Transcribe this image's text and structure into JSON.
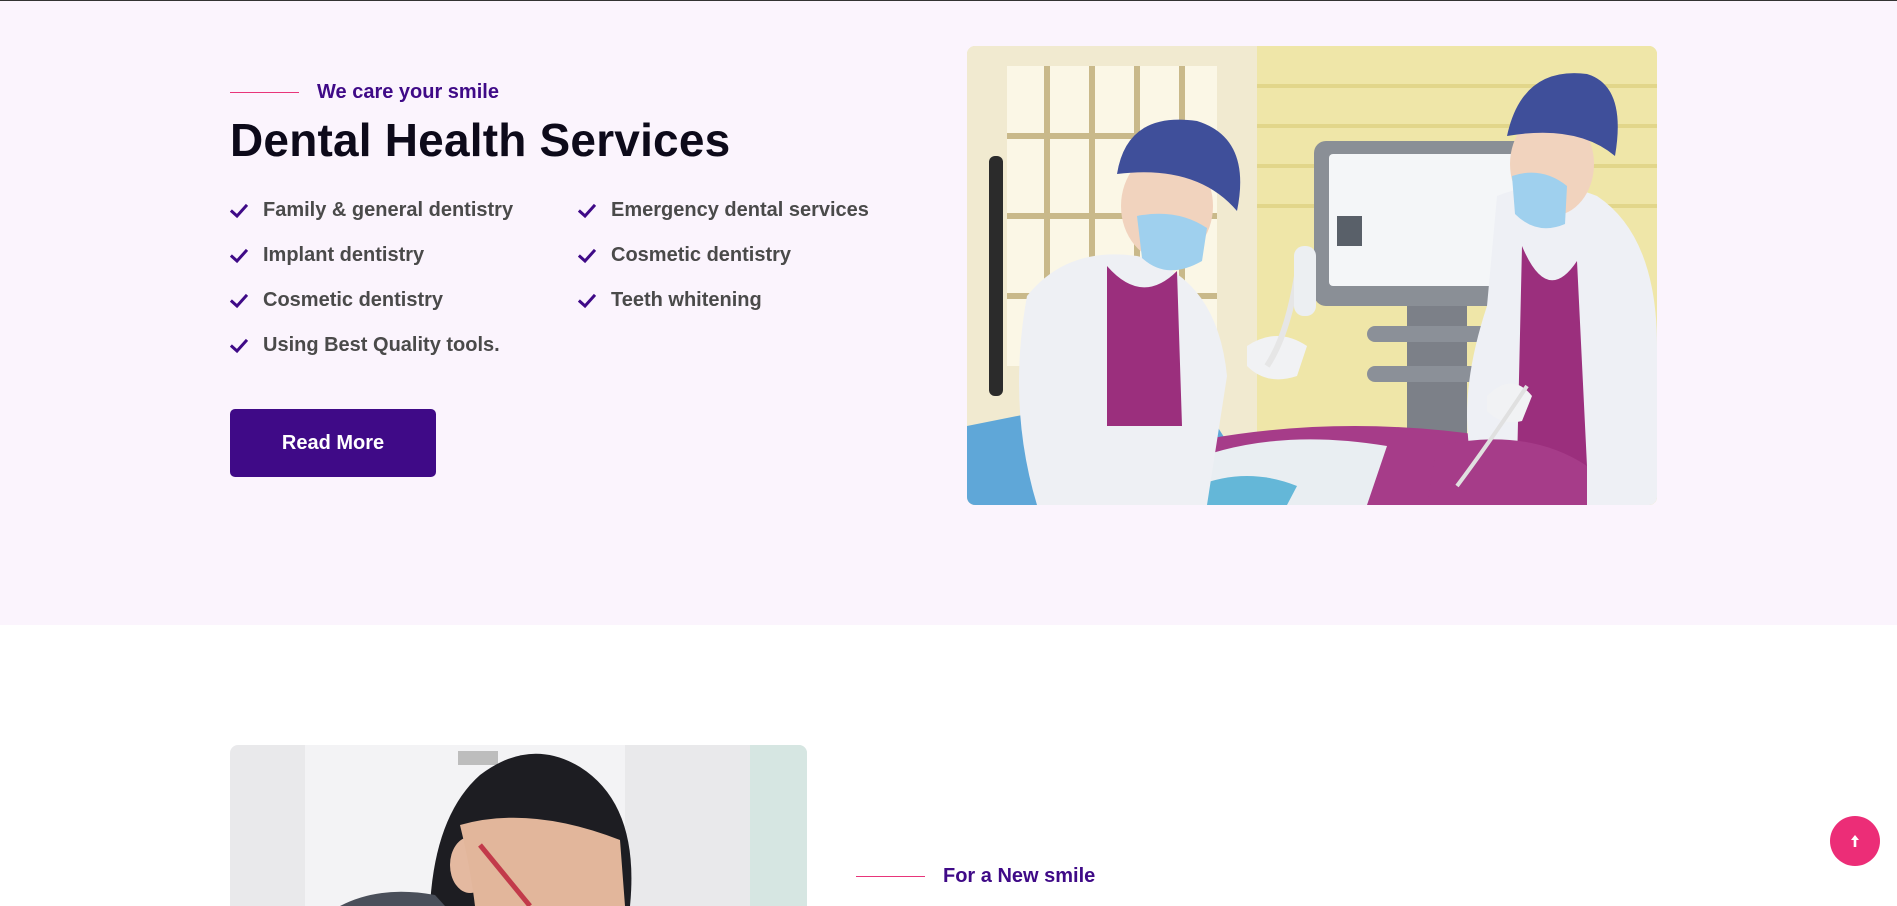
{
  "services": {
    "eyebrow": "We care your smile",
    "title": "Dental Health Services",
    "features_left": [
      "Family & general dentistry",
      "Implant dentistry",
      "Cosmetic dentistry",
      "Using Best Quality tools."
    ],
    "features_right": [
      "Emergency dental services",
      "Cosmetic dentistry",
      "Teeth whitening"
    ],
    "button_label": "Read More",
    "image_icon": "dentists-photo"
  },
  "next_section": {
    "eyebrow": "For a New smile",
    "image_icon": "dentist-photo"
  },
  "scroll_top": {
    "icon": "arrow-up-icon"
  },
  "colors": {
    "accent": "#3f0a87",
    "eyebrow_line": "#e8357a",
    "section_background": "#fbf4fd",
    "scroll_button": "#ec2d77"
  }
}
